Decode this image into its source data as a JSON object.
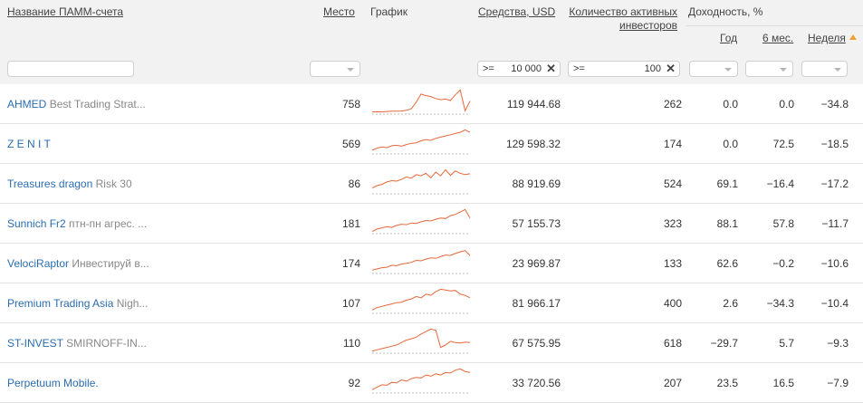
{
  "header": {
    "name_col": "Название ПАММ-счета",
    "place_col": "Место",
    "graph_col": "График",
    "funds_col": "Средства, USD",
    "investors_col": "Количество активных инвесторов",
    "yield_group": "Доходность, %",
    "year_col": "Год",
    "six_months_col": "6 мес.",
    "week_col": "Неделя"
  },
  "filters": {
    "funds": {
      "operator": ">=",
      "value": "10 000"
    },
    "investors": {
      "operator": ">=",
      "value": "100"
    }
  },
  "colors": {
    "link": "#2a6db0",
    "spark": "#e8673a",
    "header_bg": "#f2f2f2",
    "sort_arrow": "#f0a030"
  },
  "rows": [
    {
      "name": "AHMED",
      "strategy": "Best Trading Strat...",
      "place": "758",
      "funds": "119 944.68",
      "investors": "262",
      "year": "0.0",
      "six_months": "0.0",
      "week": "−34.8",
      "spark": [
        0.05,
        0.06,
        0.05,
        0.07,
        0.08,
        0.08,
        0.09,
        0.12,
        0.18,
        0.45,
        0.78,
        0.72,
        0.68,
        0.6,
        0.55,
        0.58,
        0.52,
        0.75,
        0.95,
        0.1,
        0.5
      ]
    },
    {
      "name": "Z E N I T",
      "strategy": "",
      "place": "569",
      "funds": "129 598.32",
      "investors": "174",
      "year": "0.0",
      "six_months": "72.5",
      "week": "−18.5",
      "spark": [
        0.12,
        0.2,
        0.25,
        0.22,
        0.3,
        0.32,
        0.28,
        0.35,
        0.4,
        0.42,
        0.5,
        0.55,
        0.52,
        0.6,
        0.65,
        0.7,
        0.75,
        0.8,
        0.85,
        0.95,
        0.85
      ]
    },
    {
      "name": "Treasures dragon",
      "strategy": "Risk 30",
      "place": "86",
      "funds": "88 919.69",
      "investors": "524",
      "year": "69.1",
      "six_months": "−16.4",
      "week": "−17.2",
      "spark": [
        0.2,
        0.3,
        0.35,
        0.45,
        0.5,
        0.48,
        0.55,
        0.65,
        0.6,
        0.75,
        0.7,
        0.8,
        0.62,
        0.85,
        0.7,
        0.95,
        0.72,
        0.9,
        0.8,
        0.75,
        0.78
      ]
    },
    {
      "name": "Sunnich Fr2",
      "strategy": "птн-пн агрес. ...",
      "place": "181",
      "funds": "57 155.73",
      "investors": "323",
      "year": "88.1",
      "six_months": "57.8",
      "week": "−11.7",
      "spark": [
        0.05,
        0.15,
        0.2,
        0.25,
        0.22,
        0.3,
        0.35,
        0.33,
        0.4,
        0.38,
        0.45,
        0.5,
        0.48,
        0.55,
        0.6,
        0.58,
        0.7,
        0.75,
        0.85,
        0.95,
        0.6
      ]
    },
    {
      "name": "VelociRaptor",
      "strategy": "Инвестируй в...",
      "place": "174",
      "funds": "23 969.87",
      "investors": "133",
      "year": "62.6",
      "six_months": "−0.2",
      "week": "−10.6",
      "spark": [
        0.1,
        0.15,
        0.2,
        0.22,
        0.3,
        0.28,
        0.35,
        0.38,
        0.42,
        0.5,
        0.48,
        0.55,
        0.6,
        0.58,
        0.65,
        0.72,
        0.7,
        0.78,
        0.85,
        0.9,
        0.7
      ]
    },
    {
      "name": "Premium Trading Asia",
      "strategy": "Nigh...",
      "place": "107",
      "funds": "81 966.17",
      "investors": "400",
      "year": "2.6",
      "six_months": "−34.3",
      "week": "−10.4",
      "spark": [
        0.1,
        0.2,
        0.25,
        0.3,
        0.35,
        0.4,
        0.42,
        0.5,
        0.55,
        0.65,
        0.6,
        0.75,
        0.7,
        0.85,
        0.95,
        0.92,
        0.88,
        0.9,
        0.75,
        0.7,
        0.6
      ]
    },
    {
      "name": "ST-INVEST",
      "strategy": "SMIRNOFF-IN...",
      "place": "110",
      "funds": "67 575.95",
      "investors": "618",
      "year": "−29.7",
      "six_months": "5.7",
      "week": "−9.3",
      "spark": [
        0.05,
        0.1,
        0.15,
        0.2,
        0.25,
        0.3,
        0.4,
        0.5,
        0.55,
        0.62,
        0.75,
        0.85,
        0.95,
        0.9,
        0.2,
        0.3,
        0.45,
        0.4,
        0.38,
        0.42,
        0.4
      ]
    },
    {
      "name": "Perpetuum Mobile.",
      "strategy": "",
      "place": "92",
      "funds": "33 720.56",
      "investors": "207",
      "year": "23.5",
      "six_months": "16.5",
      "week": "−7.9",
      "spark": [
        0.1,
        0.2,
        0.3,
        0.28,
        0.4,
        0.38,
        0.5,
        0.45,
        0.55,
        0.6,
        0.58,
        0.7,
        0.65,
        0.75,
        0.7,
        0.8,
        0.78,
        0.9,
        0.95,
        0.85,
        0.8
      ]
    }
  ]
}
